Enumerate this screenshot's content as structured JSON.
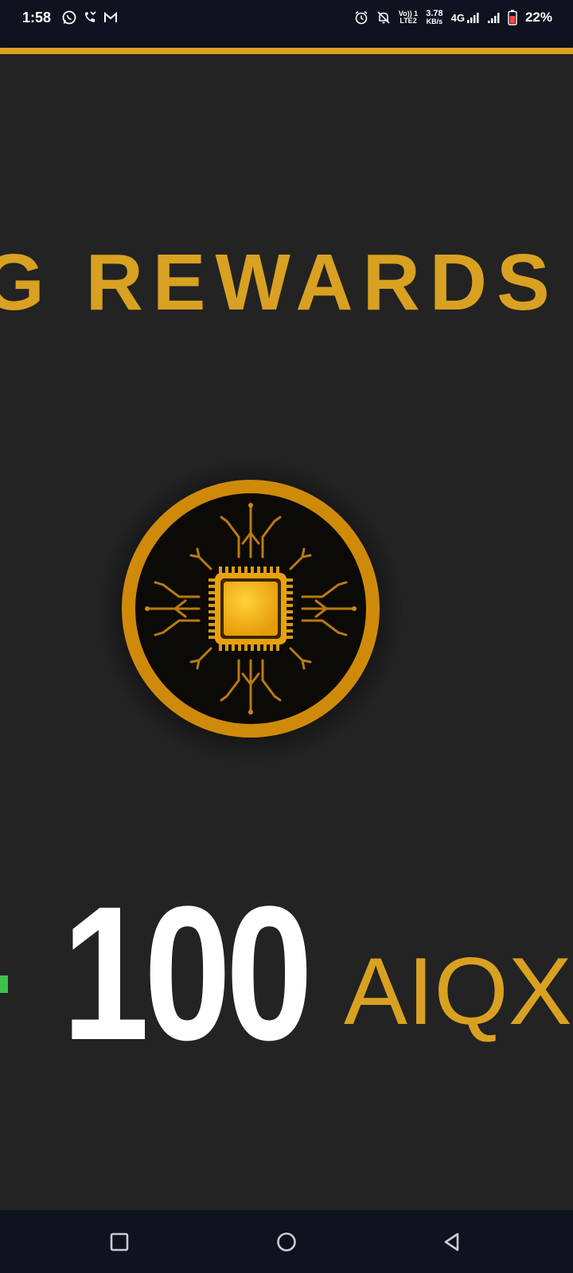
{
  "status_bar": {
    "time": "1:58",
    "left_icons": [
      "whatsapp-icon",
      "missed-call-icon",
      "gmail-icon"
    ],
    "right_icons": [
      "alarm-icon",
      "notifications-off-icon",
      "volte-icon",
      "data-speed-icon",
      "signal-4g-icon",
      "signal-icon",
      "battery-icon"
    ],
    "volte_top": "Vo)) 1",
    "volte_bottom": "LTE2",
    "data_speed_value": "3.78",
    "data_speed_unit": "KB/s",
    "network_type": "4G",
    "battery_percent": "22%"
  },
  "banner": {
    "marquee_text": "G REWARDS R"
  },
  "reward": {
    "amount": "100",
    "unit": "AIQX"
  },
  "colors": {
    "accent_gold": "#d9a121",
    "background": "#232323",
    "system_bar": "#0f1320",
    "coin_ring": "#d08a0a",
    "chip": "#f2b01c",
    "green_indicator": "#3ec14b"
  },
  "nav_bar": {
    "buttons": [
      "recents-button",
      "home-button",
      "back-button"
    ]
  }
}
